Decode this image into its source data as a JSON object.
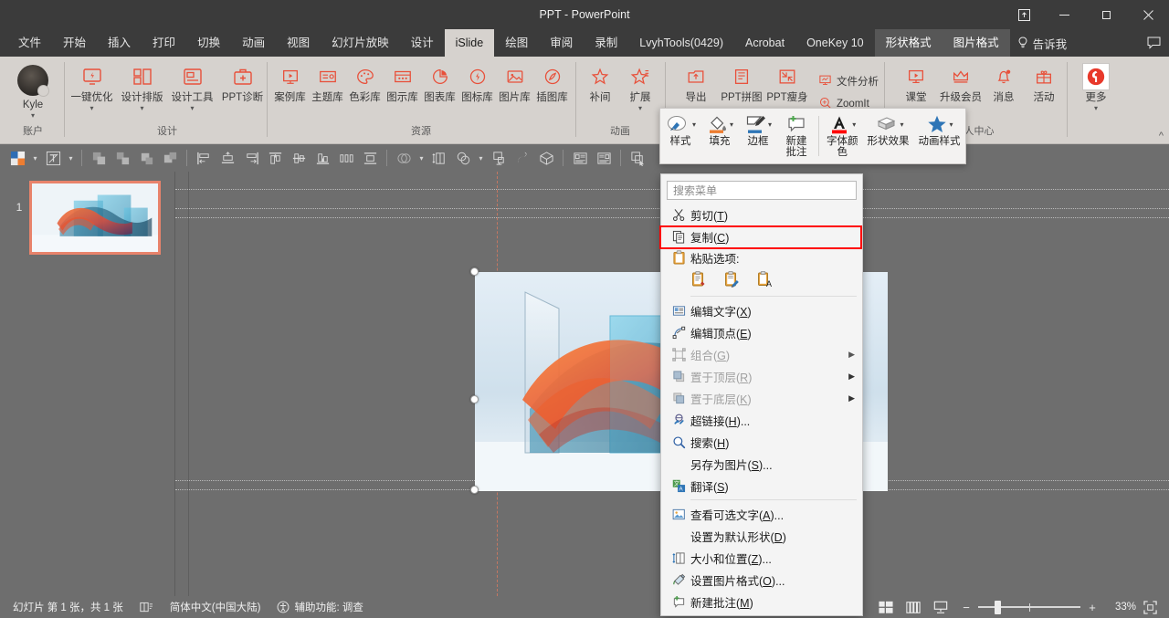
{
  "window": {
    "title": "PPT  -  PowerPoint",
    "ribbon_display_icon": "ribbon-display-options-icon",
    "minimize": "─",
    "maximize": "❐",
    "close": "✕"
  },
  "tabs": [
    {
      "label": "文件",
      "state": "normal"
    },
    {
      "label": "开始",
      "state": "normal"
    },
    {
      "label": "插入",
      "state": "normal"
    },
    {
      "label": "打印",
      "state": "normal"
    },
    {
      "label": "切换",
      "state": "normal"
    },
    {
      "label": "动画",
      "state": "normal"
    },
    {
      "label": "视图",
      "state": "normal"
    },
    {
      "label": "幻灯片放映",
      "state": "normal"
    },
    {
      "label": "设计",
      "state": "normal"
    },
    {
      "label": "iSlide",
      "state": "active"
    },
    {
      "label": "绘图",
      "state": "normal"
    },
    {
      "label": "审阅",
      "state": "normal"
    },
    {
      "label": "录制",
      "state": "normal"
    },
    {
      "label": "LvyhTools(0429)",
      "state": "normal"
    },
    {
      "label": "Acrobat",
      "state": "normal"
    },
    {
      "label": "OneKey 10",
      "state": "normal"
    },
    {
      "label": "形状格式",
      "state": "contextual"
    },
    {
      "label": "图片格式",
      "state": "contextual"
    }
  ],
  "tellme": {
    "label": "告诉我",
    "icon": "lightbulb-icon"
  },
  "share": {
    "icon": "comment-icon"
  },
  "ribbon": {
    "groups": [
      {
        "name": "账户",
        "label": "账户",
        "kind": "account",
        "items": [
          {
            "label": "Kyle",
            "icon": "user-avatar",
            "caret": true
          }
        ]
      },
      {
        "name": "设计",
        "label": "设计",
        "kind": "icons",
        "items": [
          {
            "label": "一键优化",
            "icon": "optimize-icon",
            "caret": true
          },
          {
            "label": "设计排版",
            "icon": "layout-icon",
            "caret": true
          },
          {
            "label": "设计工具",
            "icon": "design-tools-icon",
            "caret": true
          },
          {
            "label": "PPT诊断",
            "icon": "diagnose-icon",
            "caret": false
          }
        ]
      },
      {
        "name": "资源",
        "label": "资源",
        "kind": "icons",
        "items": [
          {
            "label": "案例库",
            "icon": "case-library-icon",
            "caret": false
          },
          {
            "label": "主题库",
            "icon": "theme-library-icon",
            "caret": false
          },
          {
            "label": "色彩库",
            "icon": "color-library-icon",
            "caret": false
          },
          {
            "label": "图示库",
            "icon": "diagram-library-icon",
            "caret": false
          },
          {
            "label": "图表库",
            "icon": "chart-library-icon",
            "caret": false
          },
          {
            "label": "图标库",
            "icon": "icon-library-icon",
            "caret": false
          },
          {
            "label": "图片库",
            "icon": "image-library-icon",
            "caret": false
          },
          {
            "label": "插图库",
            "icon": "illustration-library-icon",
            "caret": false
          }
        ]
      },
      {
        "name": "动画",
        "label": "动画",
        "kind": "icons",
        "items": [
          {
            "label": "补间",
            "icon": "tween-icon",
            "caret": false
          },
          {
            "label": "扩展",
            "icon": "extend-icon",
            "caret": true
          }
        ]
      },
      {
        "name": "工具",
        "label": "",
        "kind": "icons",
        "items": [
          {
            "label": "导出",
            "icon": "export-icon",
            "caret": false
          },
          {
            "label": "PPT拼图",
            "icon": "ppt-puzzle-icon",
            "caret": false
          },
          {
            "label": "PPT瘦身",
            "icon": "ppt-slim-icon",
            "caret": false
          }
        ]
      },
      {
        "name": "分析",
        "label": "",
        "kind": "rows",
        "items": [
          {
            "label": "文件分析",
            "icon": "file-analysis-icon"
          },
          {
            "label": "ZoomIt",
            "icon": "zoomit-icon"
          }
        ]
      },
      {
        "name": "用户中心",
        "label": "人中心",
        "kind": "icons",
        "items": [
          {
            "label": "课堂",
            "icon": "classroom-icon",
            "caret": false
          },
          {
            "label": "升级会员",
            "icon": "upgrade-member-icon",
            "caret": false
          },
          {
            "label": "消息",
            "icon": "bell-icon",
            "caret": false,
            "badge": true
          },
          {
            "label": "活动",
            "icon": "gift-icon",
            "caret": false
          }
        ]
      },
      {
        "name": "更多",
        "label": "",
        "kind": "icons",
        "items": [
          {
            "label": "更多",
            "icon": "islide-logo-icon",
            "caret": true
          }
        ]
      }
    ],
    "collapse_icon": "chevron-up-icon"
  },
  "minitoolbar": {
    "items": [
      {
        "label": "样式",
        "icon": "shape-style-icon",
        "caret": true
      },
      {
        "label": "填充",
        "icon": "fill-bucket-icon",
        "caret": true,
        "color": "#ED7D31"
      },
      {
        "label": "边框",
        "icon": "outline-pen-icon",
        "caret": true,
        "color": "#2E75B6"
      },
      {
        "label": "新建\n批注",
        "icon": "new-comment-icon",
        "caret": false
      },
      {
        "sep": true
      },
      {
        "label": "字体颜\n色",
        "icon": "font-color-icon",
        "caret": true,
        "color": "#FF0000"
      },
      {
        "label": "形状效果",
        "icon": "shape-effects-icon",
        "caret": true
      },
      {
        "label": "动画样式",
        "icon": "animation-style-icon",
        "caret": true,
        "color": "#2E75B6"
      }
    ]
  },
  "drawbar": {
    "items": [
      {
        "icon": "theme-colors-icon",
        "caret": true
      },
      {
        "icon": "text-direction-icon",
        "caret": true
      },
      {
        "sep": true
      },
      {
        "icon": "align-group-1-icon"
      },
      {
        "icon": "align-group-2-icon"
      },
      {
        "icon": "align-group-3-icon"
      },
      {
        "icon": "align-group-4-icon"
      },
      {
        "sep": true
      },
      {
        "icon": "align-left-icon"
      },
      {
        "icon": "align-center-icon"
      },
      {
        "icon": "align-right-icon"
      },
      {
        "icon": "align-top-icon"
      },
      {
        "icon": "align-middle-icon"
      },
      {
        "icon": "align-bottom-icon"
      },
      {
        "icon": "distribute-horizontal-icon"
      },
      {
        "icon": "distribute-vertical-icon"
      },
      {
        "sep": true
      },
      {
        "icon": "merge-shapes-icon",
        "caret": true
      },
      {
        "icon": "size-position-icon"
      },
      {
        "icon": "shape-union-icon",
        "caret": true
      },
      {
        "icon": "crop-icon"
      },
      {
        "icon": "eyedropper-icon"
      },
      {
        "icon": "3d-box-icon"
      },
      {
        "sep": true
      },
      {
        "icon": "text-align-left-icon"
      },
      {
        "icon": "text-align-right-icon"
      },
      {
        "sep": true
      },
      {
        "icon": "selection-pane-icon"
      }
    ]
  },
  "slidepanel": {
    "slides": [
      {
        "number": "1",
        "selected": true
      }
    ]
  },
  "contextmenu": {
    "search_placeholder": "搜索菜单",
    "search_icon": "search-menu-icon",
    "highlight_color": "#FF0000",
    "highlighted_item": "复制(C)",
    "items": [
      {
        "type": "item",
        "label": "剪切(",
        "accel": "T",
        "tail": ")",
        "icon": "scissors-icon",
        "disabled": false,
        "submenu": false
      },
      {
        "type": "item",
        "label": "复制(",
        "accel": "C",
        "tail": ")",
        "icon": "copy-icon",
        "disabled": false,
        "submenu": false,
        "highlighted": true
      },
      {
        "type": "paste-header",
        "label": "粘贴选项:",
        "icon": "paste-icon"
      },
      {
        "type": "paste-options",
        "options": [
          {
            "icon": "paste-keep-source-formatting-icon"
          },
          {
            "icon": "paste-picture-icon"
          },
          {
            "icon": "paste-text-only-icon"
          }
        ]
      },
      {
        "type": "sep"
      },
      {
        "type": "item",
        "label": "编辑文字(",
        "accel": "X",
        "tail": ")",
        "icon": "edit-text-icon",
        "disabled": false,
        "submenu": false
      },
      {
        "type": "item",
        "label": "编辑顶点(",
        "accel": "E",
        "tail": ")",
        "icon": "edit-points-icon",
        "disabled": false,
        "submenu": false
      },
      {
        "type": "item",
        "label": "组合(",
        "accel": "G",
        "tail": ")",
        "icon": "group-icon",
        "disabled": true,
        "submenu": true
      },
      {
        "type": "item",
        "label": "置于顶层(",
        "accel": "R",
        "tail": ")",
        "icon": "bring-front-icon",
        "disabled": true,
        "submenu": true
      },
      {
        "type": "item",
        "label": "置于底层(",
        "accel": "K",
        "tail": ")",
        "icon": "send-back-icon",
        "disabled": true,
        "submenu": true
      },
      {
        "type": "item",
        "label": "超链接(",
        "accel": "H",
        "tail": ")...",
        "icon": "hyperlink-icon",
        "disabled": false,
        "submenu": false
      },
      {
        "type": "item",
        "label": "搜索(",
        "accel": "H",
        "tail": ")",
        "icon": "search-icon",
        "disabled": false,
        "submenu": false
      },
      {
        "type": "item",
        "label": "另存为图片(",
        "accel": "S",
        "tail": ")...",
        "icon": "none",
        "disabled": false,
        "submenu": false
      },
      {
        "type": "item",
        "label": "翻译(",
        "accel": "S",
        "tail": ")",
        "icon": "translate-icon",
        "disabled": false,
        "submenu": false
      },
      {
        "type": "sep"
      },
      {
        "type": "item",
        "label": "查看可选文字(",
        "accel": "A",
        "tail": ")...",
        "icon": "alt-text-icon",
        "disabled": false,
        "submenu": false
      },
      {
        "type": "item",
        "label": "设置为默认形状(",
        "accel": "D",
        "tail": ")",
        "icon": "none",
        "disabled": false,
        "submenu": false
      },
      {
        "type": "item",
        "label": "大小和位置(",
        "accel": "Z",
        "tail": ")...",
        "icon": "size-position-menu-icon",
        "disabled": false,
        "submenu": false
      },
      {
        "type": "item",
        "label": "设置图片格式(",
        "accel": "O",
        "tail": ")...",
        "icon": "format-picture-icon",
        "disabled": false,
        "submenu": false
      },
      {
        "type": "item",
        "label": "新建批注(",
        "accel": "M",
        "tail": ")",
        "icon": "new-comment-menu-icon",
        "disabled": false,
        "submenu": false
      }
    ]
  },
  "statusbar": {
    "slide_info": "幻灯片 第 1 张，共 1 张",
    "notes_icon": "notes-icon",
    "language": "简体中文(中国大陆)",
    "accessibility_icon": "accessibility-icon",
    "accessibility": "辅助功能: 调查",
    "views": [
      {
        "icon": "normal-view-icon",
        "active": false
      },
      {
        "icon": "slide-sorter-icon",
        "active": false
      },
      {
        "icon": "reading-view-icon",
        "active": false
      }
    ],
    "zoom": {
      "minus": "−",
      "plus": "+",
      "value": "33%",
      "percent": 33
    },
    "fit_icon": "fit-to-window-icon"
  }
}
